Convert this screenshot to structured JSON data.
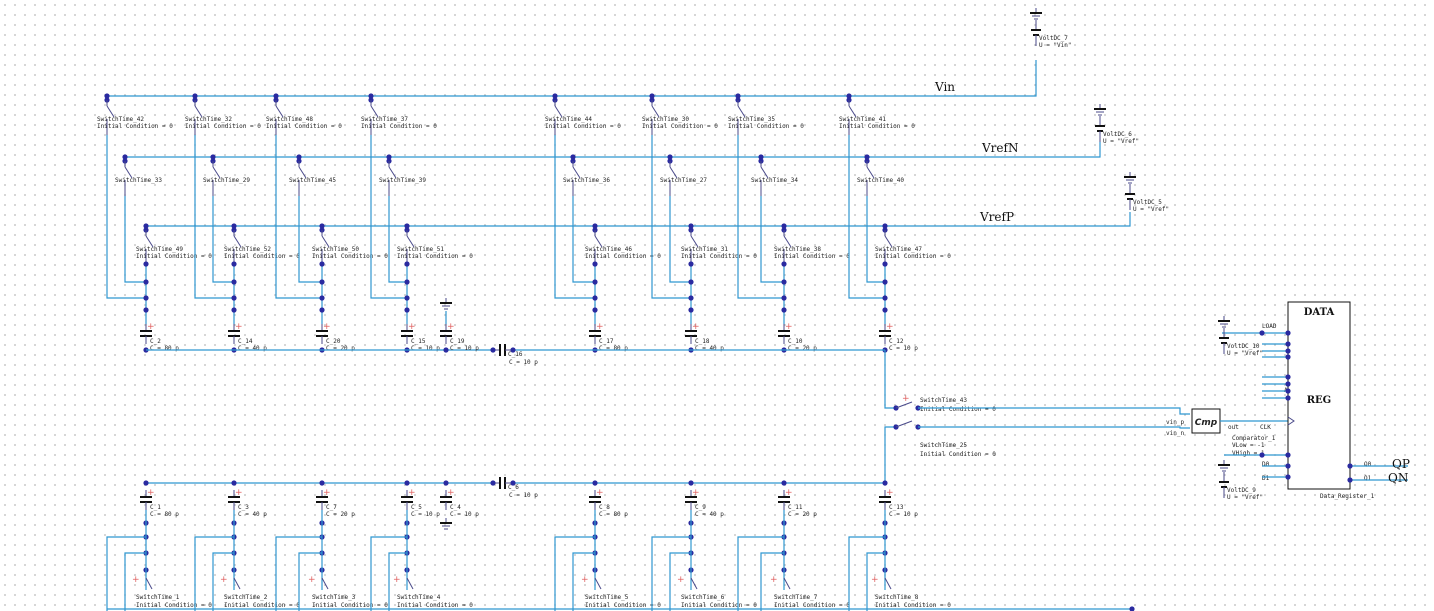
{
  "nets": {
    "vin": "Vin",
    "vrefn": "VrefN",
    "vrefp": "VrefP",
    "qp": "QP",
    "qn": "QN"
  },
  "initial_condition": "Initial Condition = 0",
  "top_col_x": [
    107,
    195,
    276,
    371,
    555,
    652,
    738,
    849
  ],
  "top_rows": {
    "row1": [
      "SwitchTime_42",
      "SwitchTime_32",
      "SwitchTime_48",
      "SwitchTime_37",
      "SwitchTime_44",
      "SwitchTime_30",
      "SwitchTime_35",
      "SwitchTime_41"
    ],
    "row2": [
      "SwitchTime_33",
      "SwitchTime_29",
      "SwitchTime_45",
      "SwitchTime_39",
      "SwitchTime_36",
      "SwitchTime_27",
      "SwitchTime_34",
      "SwitchTime_40"
    ],
    "row3": [
      "SwitchTime_49",
      "SwitchTime_52",
      "SwitchTime_50",
      "SwitchTime_51",
      "SwitchTime_46",
      "SwitchTime_31",
      "SwitchTime_38",
      "SwitchTime_47"
    ]
  },
  "top_caps": [
    {
      "name": "C_2",
      "value": "C = 80 p"
    },
    {
      "name": "C_14",
      "value": "C = 40 p"
    },
    {
      "name": "C_20",
      "value": "C = 20 p"
    },
    {
      "name": "C_15",
      "value": "C = 10 p"
    },
    {
      "name": "C_17",
      "value": "C = 80 p"
    },
    {
      "name": "C_18",
      "value": "C = 40 p"
    },
    {
      "name": "C_10",
      "value": "C = 20 p"
    },
    {
      "name": "C_12",
      "value": "C = 10 p"
    }
  ],
  "top_dummy_cap": {
    "name": "C_19",
    "value": "C = 10 p"
  },
  "top_bridge_cap": {
    "name": "C_16",
    "value": "C = 10 p"
  },
  "bottom_caps": [
    {
      "name": "C_1",
      "value": "C = 80 p"
    },
    {
      "name": "C_3",
      "value": "C = 40 p"
    },
    {
      "name": "C_7",
      "value": "C = 20 p"
    },
    {
      "name": "C_5",
      "value": "C = 10 p"
    },
    {
      "name": "C_8",
      "value": "C = 80 p"
    },
    {
      "name": "C_9",
      "value": "C = 40 p"
    },
    {
      "name": "C_11",
      "value": "C = 20 p"
    },
    {
      "name": "C_13",
      "value": "C = 10 p"
    }
  ],
  "bottom_dummy_cap": {
    "name": "C_4",
    "value": "C = 10 p"
  },
  "bottom_bridge_cap": {
    "name": "C_6",
    "value": "C = 10 p"
  },
  "bottom_switches": [
    "SwitchTime_1",
    "SwitchTime_2",
    "SwitchTime_3",
    "SwitchTime_4",
    "SwitchTime_5",
    "SwitchTime_6",
    "SwitchTime_7",
    "SwitchTime_8"
  ],
  "sample_switches": {
    "top": "SwitchTime_43",
    "bottom": "SwitchTime_25"
  },
  "sources": {
    "vin": {
      "name": "VoltDC_7",
      "value": "U = \"Vin\""
    },
    "vrefn": {
      "name": "VoltDC_6",
      "value": "U = \"Vref\""
    },
    "vrefp": {
      "name": "VoltDC_5",
      "value": "U = \"Vref\""
    },
    "reg_top": {
      "name": "VoltDC_10",
      "value": "U = \"Vref\""
    },
    "reg_bot": {
      "name": "VoltDC_9",
      "value": "U = \"Vref\""
    }
  },
  "comparator": {
    "symbol": "Cmp",
    "name": "Comparator_1",
    "vlow": "VLow = -1",
    "vhigh": "VHigh = 1",
    "pin_p": "vin_p",
    "pin_n": "vin_n",
    "pin_out": "out"
  },
  "register": {
    "title": "DATA",
    "label": "REG",
    "name": "Data_Register_1",
    "pin_load": "LOAD",
    "pin_a": "A",
    "pin_clk": "CLK",
    "pin_d0": "D0",
    "pin_d1": "D1",
    "pin_q0": "Q0",
    "pin_q1": "Q1"
  }
}
